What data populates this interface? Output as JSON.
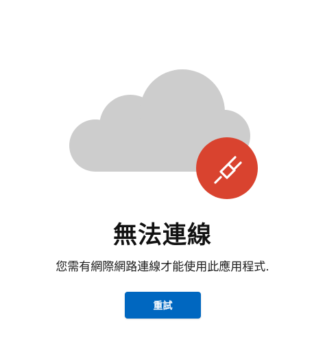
{
  "error": {
    "title": "無法連線",
    "message": "您需有網際網路連線才能使用此應用程式.",
    "retry_label": "重試"
  },
  "icons": {
    "cloud": "cloud-icon",
    "badge": "plug-icon"
  },
  "colors": {
    "cloud": "#cdcdcd",
    "badge": "#d9432f",
    "button": "#0067c0"
  }
}
